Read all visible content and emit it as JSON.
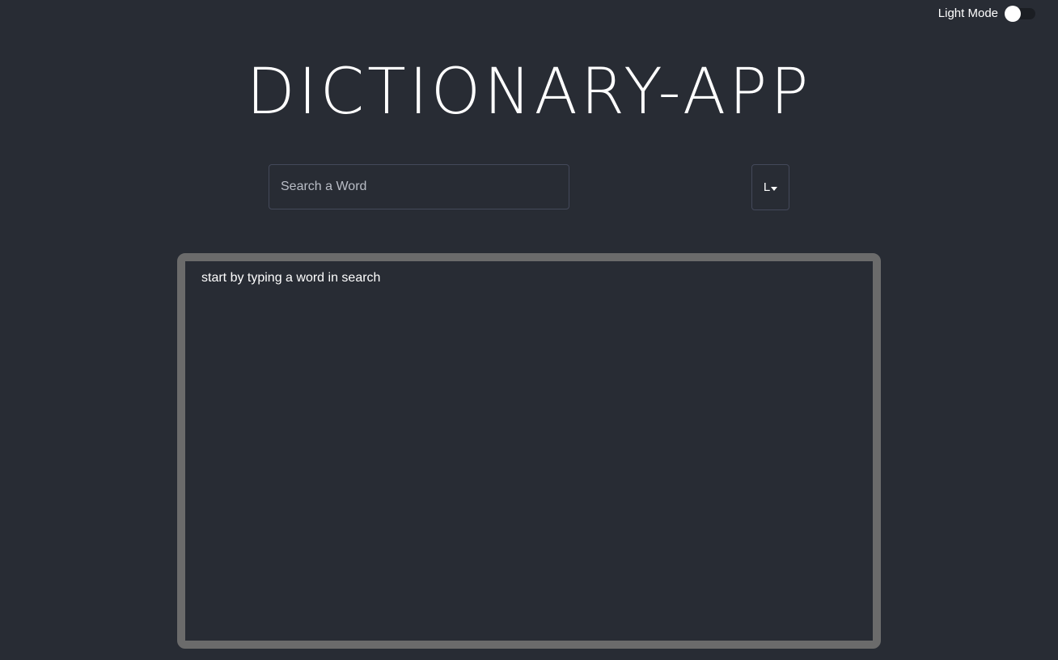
{
  "header": {
    "mode_label": "Light Mode",
    "title": "DICTIONARY-APP"
  },
  "search": {
    "placeholder": "Search a Word",
    "value": ""
  },
  "language_select": {
    "selected": "L"
  },
  "results": {
    "hint": "start by typing a word in search"
  },
  "colors": {
    "background": "#282c34",
    "results_border": "#6b6b6b",
    "input_border": "#44495a",
    "text": "#ffffff"
  }
}
